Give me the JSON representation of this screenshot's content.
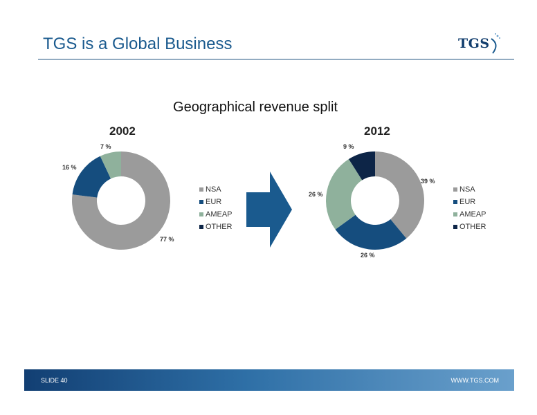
{
  "header": {
    "title": "TGS is a Global Business",
    "logo_text": "TGS"
  },
  "subtitle": "Geographical revenue split",
  "colors": {
    "NSA": "#9b9b9b",
    "EUR": "#154d7e",
    "AMEAP": "#8fb19c",
    "OTHER": "#0d2547",
    "arrow": "#1a5a8e"
  },
  "chart_data": [
    {
      "type": "pie",
      "title": "2002",
      "categories": [
        "NSA",
        "EUR",
        "AMEAP",
        "OTHER"
      ],
      "values": [
        77,
        16,
        7,
        0
      ],
      "data_labels": [
        "77 %",
        "16 %",
        "7 %"
      ],
      "legend": [
        "NSA",
        "EUR",
        "AMEAP",
        "OTHER"
      ],
      "legend_position": "right"
    },
    {
      "type": "pie",
      "title": "2012",
      "categories": [
        "NSA",
        "EUR",
        "AMEAP",
        "OTHER"
      ],
      "values": [
        39,
        26,
        26,
        9
      ],
      "data_labels": [
        "39 %",
        "26 %",
        "26 %",
        "9 %"
      ],
      "legend": [
        "NSA",
        "EUR",
        "AMEAP",
        "OTHER"
      ],
      "legend_position": "right"
    }
  ],
  "footer": {
    "slide": "SLIDE 40",
    "url": "WWW.TGS.COM"
  }
}
